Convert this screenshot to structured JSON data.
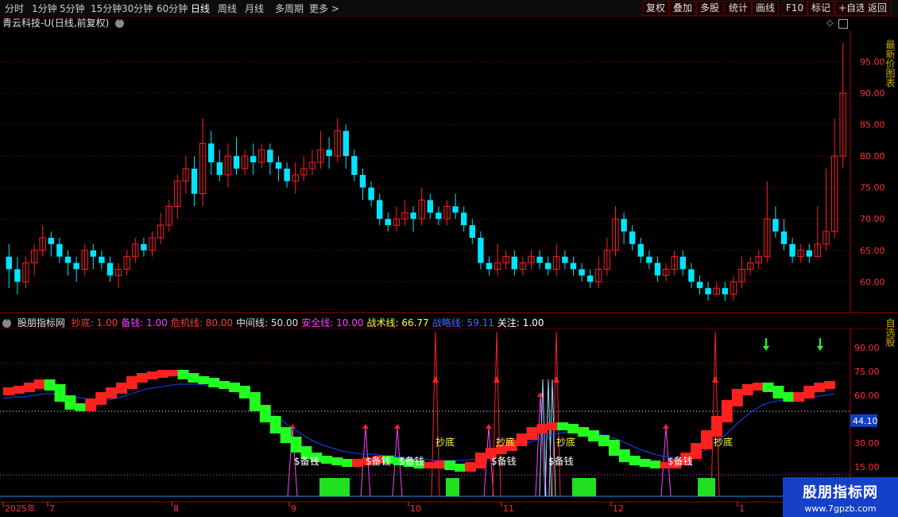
{
  "toolbar": {
    "periods": [
      "分时",
      "1分钟",
      "5分钟",
      "15分钟",
      "30分钟",
      "60分钟",
      "日线",
      "周线",
      "月线",
      "多周期",
      "更多"
    ],
    "selected": "日线",
    "right_buttons": [
      "复权",
      "叠加",
      "多股",
      "统计",
      "画线",
      "F10",
      "标记",
      "+自选",
      "返回"
    ]
  },
  "main": {
    "title": "青云科技-U(日线,前复权)",
    "y_ticks": [
      "95.00",
      "90.00",
      "85.00",
      "80.00",
      "75.00",
      "70.00",
      "65.00",
      "60.00"
    ],
    "right_vertical_text": "最新价图表"
  },
  "indicator": {
    "name": "股朋指标网",
    "params": [
      {
        "label": "抄底:",
        "value": "1.00",
        "color": "#ff3b3b"
      },
      {
        "label": "备钱:",
        "value": "1.00",
        "color": "#ff40ff"
      },
      {
        "label": "危机线:",
        "value": "80.00",
        "color": "#ff3b3b"
      },
      {
        "label": "中间线:",
        "value": "50.00",
        "color": "#e0e0e0"
      },
      {
        "label": "安全线:",
        "value": "10.00",
        "color": "#ff40ff"
      },
      {
        "label": "战术线:",
        "value": "66.77",
        "color": "#ffff40"
      },
      {
        "label": "战略线:",
        "value": "59.11",
        "color": "#4a6cff"
      },
      {
        "label": "关注:",
        "value": "1.00",
        "color": "#ffffff"
      }
    ],
    "y_ticks": [
      "90.00",
      "75.00",
      "60.00",
      "44.10",
      "30.00",
      "15.00"
    ],
    "current_value": "44.10",
    "signal_labels": [
      {
        "text": "$备钱",
        "color": "#ffffff"
      },
      {
        "text": "$备钱",
        "color": "#ffffff"
      },
      {
        "text": "$备钱",
        "color": "#ffffff"
      },
      {
        "text": "抄底",
        "color": "#ffff40"
      },
      {
        "text": "$备钱",
        "color": "#ffffff"
      },
      {
        "text": "抄底",
        "color": "#ffff40"
      },
      {
        "text": "$备钱",
        "color": "#ffffff"
      },
      {
        "text": "抄底",
        "color": "#ffff40"
      },
      {
        "text": "$备钱",
        "color": "#ffffff"
      },
      {
        "text": "抄底",
        "color": "#ffff40"
      }
    ],
    "right_vertical_text": "自选股"
  },
  "timeline": {
    "labels": [
      "2025年",
      "7",
      "8",
      "9",
      "10",
      "11",
      "12",
      "1"
    ]
  },
  "watermark": {
    "title": "股朋指标网",
    "url": "www.7gpzb.com"
  },
  "colors": {
    "up": "#ff2020",
    "down": "#00e5ff",
    "tactic_up": "#ff2020",
    "tactic_down": "#20ff20",
    "strategy": "#2040ff",
    "grid": "#a00000",
    "axis_text": "#ff3030"
  },
  "chart_data": [
    {
      "type": "candlestick",
      "title": "青云科技-U(日线,前复权)",
      "ylim": [
        57,
        99
      ],
      "candles": [
        [
          64,
          62,
          66,
          59
        ],
        [
          62,
          60,
          64,
          58
        ],
        [
          60,
          63,
          64,
          59
        ],
        [
          63,
          65,
          66,
          61
        ],
        [
          65,
          67,
          69,
          64
        ],
        [
          67,
          66,
          68,
          64
        ],
        [
          66,
          64,
          67,
          63
        ],
        [
          64,
          63,
          65,
          61
        ],
        [
          63,
          62,
          64,
          60
        ],
        [
          62,
          65,
          66,
          61
        ],
        [
          65,
          64,
          66,
          62
        ],
        [
          64,
          63,
          65,
          62
        ],
        [
          63,
          61,
          64,
          60
        ],
        [
          61,
          62,
          63,
          59
        ],
        [
          62,
          64,
          65,
          61
        ],
        [
          64,
          66,
          67,
          63
        ],
        [
          66,
          65,
          67,
          64
        ],
        [
          65,
          67,
          68,
          64
        ],
        [
          67,
          69,
          71,
          66
        ],
        [
          69,
          72,
          73,
          68
        ],
        [
          72,
          76,
          77,
          70
        ],
        [
          76,
          78,
          80,
          74
        ],
        [
          78,
          74,
          80,
          72
        ],
        [
          74,
          82,
          86,
          72
        ],
        [
          82,
          79,
          84,
          77
        ],
        [
          79,
          77,
          81,
          76
        ],
        [
          77,
          80,
          82,
          75
        ],
        [
          80,
          78,
          83,
          77
        ],
        [
          78,
          80,
          81,
          77
        ],
        [
          80,
          79,
          82,
          77
        ],
        [
          79,
          81,
          82,
          78
        ],
        [
          81,
          79,
          82,
          77
        ],
        [
          79,
          78,
          80,
          76
        ],
        [
          78,
          76,
          79,
          75
        ],
        [
          76,
          77,
          79,
          74
        ],
        [
          77,
          78,
          80,
          76
        ],
        [
          78,
          79,
          81,
          77
        ],
        [
          79,
          81,
          84,
          78
        ],
        [
          81,
          80,
          83,
          78
        ],
        [
          80,
          84,
          86,
          79
        ],
        [
          84,
          80,
          85,
          78
        ],
        [
          80,
          77,
          81,
          76
        ],
        [
          77,
          75,
          78,
          73
        ],
        [
          75,
          73,
          76,
          72
        ],
        [
          73,
          70,
          74,
          69
        ],
        [
          70,
          69,
          71,
          68
        ],
        [
          69,
          70,
          72,
          68
        ],
        [
          70,
          71,
          73,
          69
        ],
        [
          71,
          70,
          72,
          68
        ],
        [
          70,
          73,
          75,
          69
        ],
        [
          73,
          71,
          74,
          70
        ],
        [
          71,
          70,
          72,
          69
        ],
        [
          70,
          72,
          73,
          69
        ],
        [
          72,
          71,
          74,
          70
        ],
        [
          71,
          69,
          72,
          68
        ],
        [
          69,
          67,
          70,
          66
        ],
        [
          67,
          63,
          68,
          62
        ],
        [
          63,
          62,
          64,
          61
        ],
        [
          62,
          63,
          66,
          61
        ],
        [
          63,
          64,
          65,
          62
        ],
        [
          64,
          62,
          65,
          61
        ],
        [
          62,
          63,
          64,
          61
        ],
        [
          63,
          64,
          65,
          62
        ],
        [
          64,
          63,
          65,
          62
        ],
        [
          63,
          62,
          64,
          61
        ],
        [
          62,
          64,
          66,
          61
        ],
        [
          64,
          63,
          65,
          62
        ],
        [
          63,
          62,
          64,
          61
        ],
        [
          62,
          61,
          63,
          60
        ],
        [
          61,
          60,
          62,
          59
        ],
        [
          60,
          62,
          64,
          59
        ],
        [
          62,
          65,
          67,
          61
        ],
        [
          65,
          70,
          72,
          64
        ],
        [
          70,
          68,
          71,
          66
        ],
        [
          68,
          66,
          69,
          65
        ],
        [
          66,
          64,
          67,
          63
        ],
        [
          64,
          63,
          65,
          62
        ],
        [
          63,
          61,
          64,
          60
        ],
        [
          61,
          62,
          63,
          60
        ],
        [
          62,
          64,
          65,
          61
        ],
        [
          64,
          62,
          65,
          61
        ],
        [
          62,
          60,
          63,
          59
        ],
        [
          60,
          59,
          61,
          58
        ],
        [
          59,
          58,
          60,
          57
        ],
        [
          58,
          59,
          60,
          58
        ],
        [
          59,
          58,
          60,
          57
        ],
        [
          58,
          60,
          61,
          57
        ],
        [
          60,
          62,
          64,
          59
        ],
        [
          62,
          63,
          64,
          61
        ],
        [
          63,
          64,
          65,
          62
        ],
        [
          64,
          70,
          76,
          63
        ],
        [
          70,
          68,
          72,
          67
        ],
        [
          68,
          66,
          70,
          65
        ],
        [
          66,
          64,
          67,
          63
        ],
        [
          64,
          65,
          66,
          63
        ],
        [
          65,
          64,
          66,
          63
        ],
        [
          64,
          66,
          72,
          64
        ],
        [
          66,
          68,
          78,
          65
        ],
        [
          68,
          80,
          86,
          67
        ],
        [
          80,
          90,
          98,
          78
        ]
      ]
    },
    {
      "type": "line",
      "title": "股朋指标网",
      "ylim": [
        0,
        100
      ],
      "series": [
        {
          "name": "战术线",
          "values": [
            62,
            63,
            64,
            66,
            68,
            65,
            58,
            53,
            52,
            56,
            60,
            63,
            66,
            70,
            72,
            73,
            74,
            74,
            72,
            70,
            69,
            67,
            66,
            64,
            60,
            52,
            45,
            38,
            32,
            26,
            22,
            20,
            19,
            18,
            17,
            18,
            19,
            20,
            19,
            18,
            17,
            16,
            16,
            17,
            15,
            14,
            16,
            22,
            25,
            27,
            30,
            34,
            38,
            40,
            41,
            40,
            38,
            36,
            33,
            30,
            24,
            20,
            18,
            17,
            16,
            16,
            18,
            22,
            28,
            36,
            45,
            55,
            62,
            65,
            66,
            64,
            60,
            58,
            60,
            64,
            66,
            67
          ]
        },
        {
          "name": "战略线",
          "values": [
            58,
            59,
            59,
            60,
            61,
            61,
            60,
            59,
            58,
            57,
            57,
            58,
            60,
            62,
            64,
            65,
            66,
            67,
            67,
            67,
            66,
            65,
            64,
            62,
            58,
            54,
            49,
            45,
            40,
            36,
            32,
            29,
            27,
            25,
            24,
            23,
            23,
            22,
            22,
            21,
            20,
            20,
            19,
            19,
            19,
            19,
            20,
            22,
            24,
            26,
            28,
            30,
            32,
            34,
            36,
            37,
            37,
            37,
            36,
            34,
            32,
            29,
            26,
            24,
            22,
            21,
            21,
            22,
            24,
            28,
            33,
            39,
            45,
            50,
            54,
            56,
            57,
            57,
            58,
            59,
            60,
            61
          ]
        }
      ]
    }
  ]
}
